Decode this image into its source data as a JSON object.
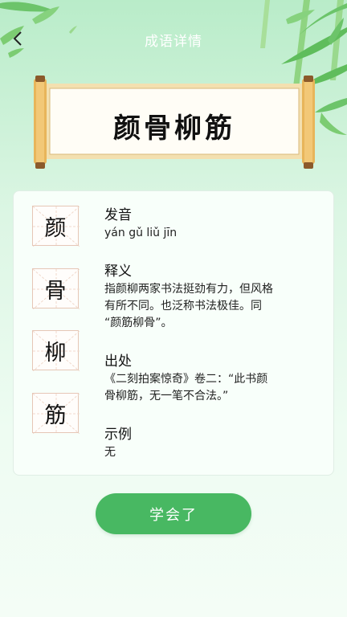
{
  "header": {
    "title": "成语详情"
  },
  "idiom": {
    "title": "颜骨柳筋",
    "chars": [
      "颜",
      "骨",
      "柳",
      "筋"
    ]
  },
  "sections": {
    "pronunciation": {
      "label": "发音",
      "text": "yán gǔ liǔ jīn"
    },
    "meaning": {
      "label": "释义",
      "lines": [
        "指颜柳两家书法挺劲有力，但风格",
        "有所不同。也泛称书法极佳。同",
        "“颜筋柳骨”。"
      ]
    },
    "source": {
      "label": "出处",
      "lines": [
        "《二刻拍案惊奇》卷二：“此书颜",
        "骨柳筋，无一笔不合法。”"
      ]
    },
    "example": {
      "label": "示例",
      "text": "无"
    }
  },
  "actions": {
    "learned_label": "学会了"
  },
  "colors": {
    "accent": "#48b862",
    "card_bg": "#f8fffa",
    "grid_border": "#e6c6b6"
  }
}
